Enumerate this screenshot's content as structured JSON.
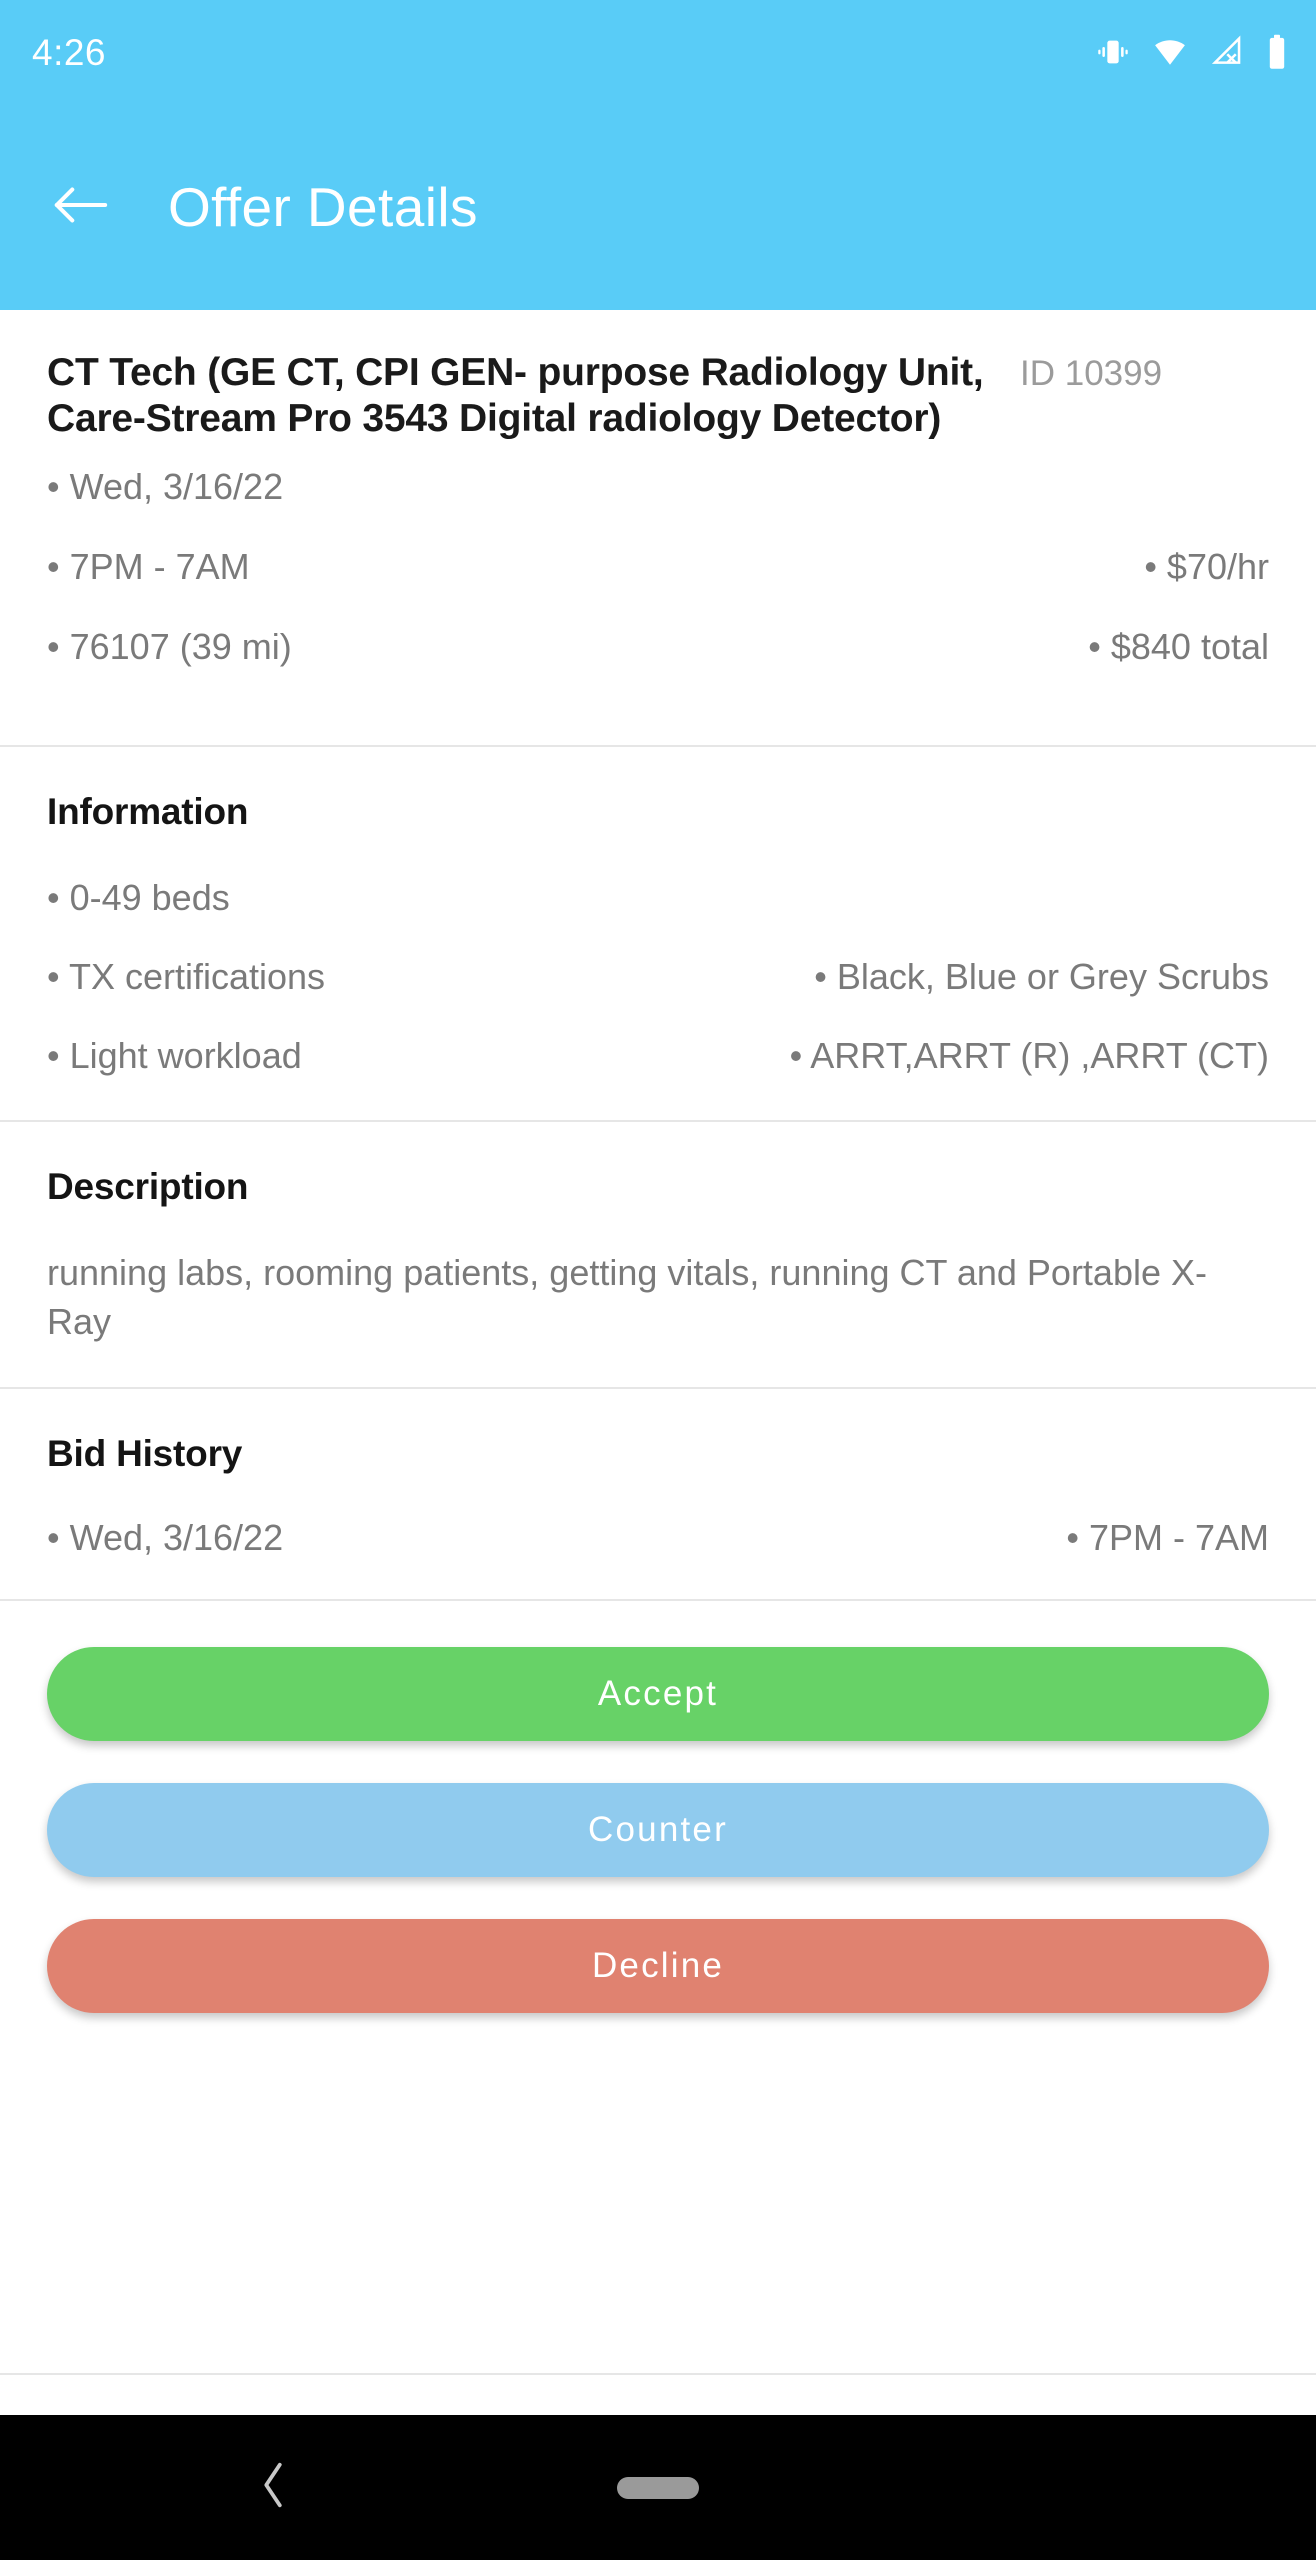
{
  "status_bar": {
    "time": "4:26",
    "icons": [
      "vibrate-icon",
      "wifi-icon",
      "cellular-off-icon",
      "battery-icon"
    ]
  },
  "app_bar": {
    "back_icon": "arrow-left-icon",
    "title": "Offer Details",
    "background_color": "#59CCF7"
  },
  "offer": {
    "title": "CT Tech (GE CT, CPI GEN- purpose Radiology Unit, Care-Stream Pro 3543 Digital radiology Detector)",
    "id_label": "ID 10399",
    "meta_rows": [
      {
        "left": "Wed, 3/16/22",
        "right": ""
      },
      {
        "left": "7PM - 7AM",
        "right": "$70/hr"
      },
      {
        "left": "76107 (39 mi)",
        "right": "$840 total"
      }
    ]
  },
  "information": {
    "heading": "Information",
    "rows": [
      {
        "left": "0-49 beds",
        "right": ""
      },
      {
        "left": "TX certifications",
        "right": "Black, Blue or Grey Scrubs"
      },
      {
        "left": "Light workload",
        "right": "ARRT,ARRT (R) ,ARRT (CT)"
      }
    ]
  },
  "description": {
    "heading": "Description",
    "text": "running labs, rooming patients, getting vitals, running CT and Portable X-Ray"
  },
  "bid_history": {
    "heading": "Bid History",
    "rows": [
      {
        "left": "Wed, 3/16/22",
        "right": "7PM - 7AM"
      }
    ]
  },
  "actions": {
    "accept": {
      "label": "Accept",
      "color": "#67D267"
    },
    "counter": {
      "label": "Counter",
      "color": "#90CBEE"
    },
    "decline": {
      "label": "Decline",
      "color": "#E08270"
    }
  },
  "nav_bar": {
    "back_icon": "chevron-left-icon",
    "home_indicator": "home-pill-indicator",
    "background_color": "#000000"
  }
}
